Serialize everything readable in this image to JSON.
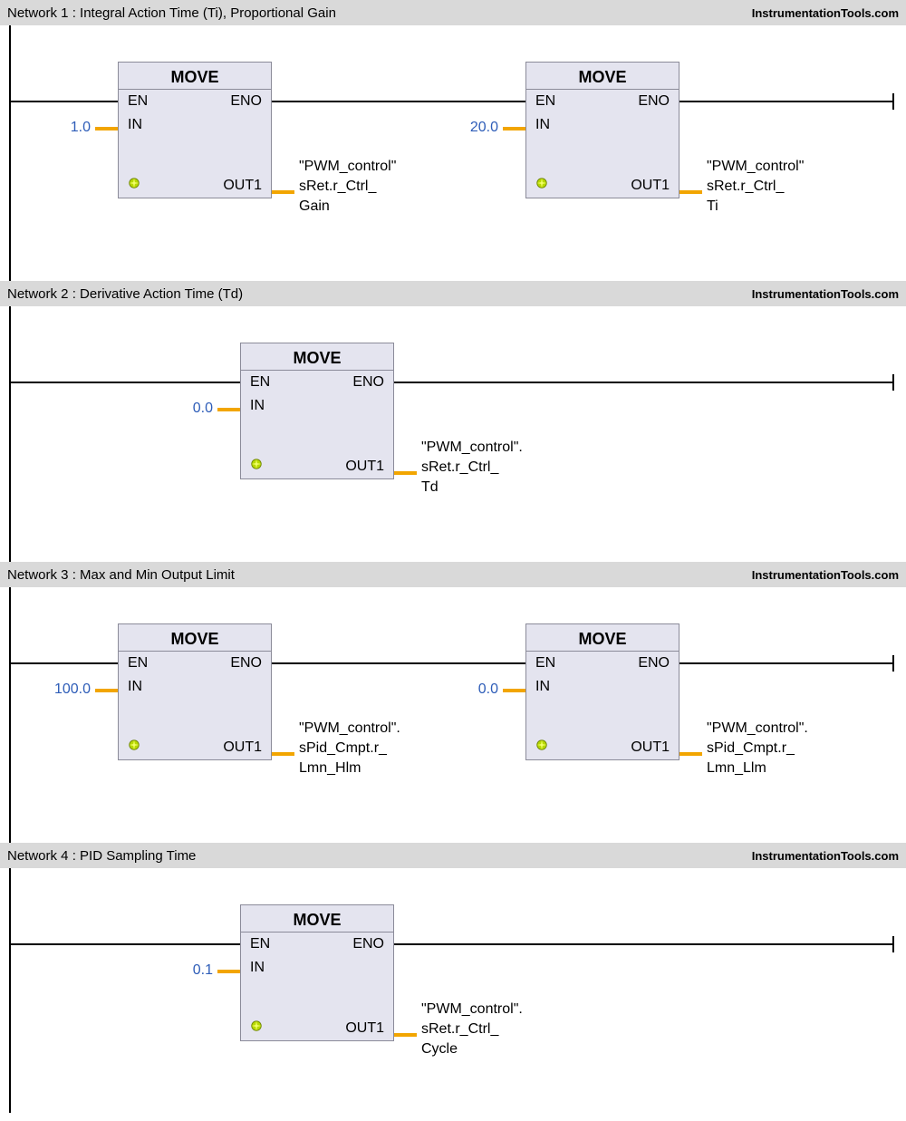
{
  "watermark": "InstrumentationTools.com",
  "networks": [
    {
      "id": 1,
      "title": "Network 1 : Integral Action Time (Ti), Proportional Gain",
      "blocks": [
        {
          "type": "MOVE",
          "en": "EN",
          "eno": "ENO",
          "in_label": "IN",
          "out_label": "OUT1",
          "in_value": "1.0",
          "out_value": "\"PWM_control\"\nsRet.r_Ctrl_\nGain"
        },
        {
          "type": "MOVE",
          "en": "EN",
          "eno": "ENO",
          "in_label": "IN",
          "out_label": "OUT1",
          "in_value": "20.0",
          "out_value": "\"PWM_control\"\nsRet.r_Ctrl_\nTi"
        }
      ]
    },
    {
      "id": 2,
      "title": "Network  2 : Derivative Action Time (Td)",
      "blocks": [
        {
          "type": "MOVE",
          "en": "EN",
          "eno": "ENO",
          "in_label": "IN",
          "out_label": "OUT1",
          "in_value": "0.0",
          "out_value": "\"PWM_control\".\nsRet.r_Ctrl_\nTd"
        }
      ]
    },
    {
      "id": 3,
      "title": "Network  3 : Max and Min Output Limit",
      "blocks": [
        {
          "type": "MOVE",
          "en": "EN",
          "eno": "ENO",
          "in_label": "IN",
          "out_label": "OUT1",
          "in_value": "100.0",
          "out_value": "\"PWM_control\".\nsPid_Cmpt.r_\nLmn_Hlm"
        },
        {
          "type": "MOVE",
          "en": "EN",
          "eno": "ENO",
          "in_label": "IN",
          "out_label": "OUT1",
          "in_value": "0.0",
          "out_value": "\"PWM_control\".\nsPid_Cmpt.r_\nLmn_Llm"
        }
      ]
    },
    {
      "id": 4,
      "title": "Network 4 : PID Sampling Time",
      "blocks": [
        {
          "type": "MOVE",
          "en": "EN",
          "eno": "ENO",
          "in_label": "IN",
          "out_label": "OUT1",
          "in_value": "0.1",
          "out_value": "\"PWM_control\".\nsRet.r_Ctrl_\nCycle"
        }
      ]
    }
  ]
}
